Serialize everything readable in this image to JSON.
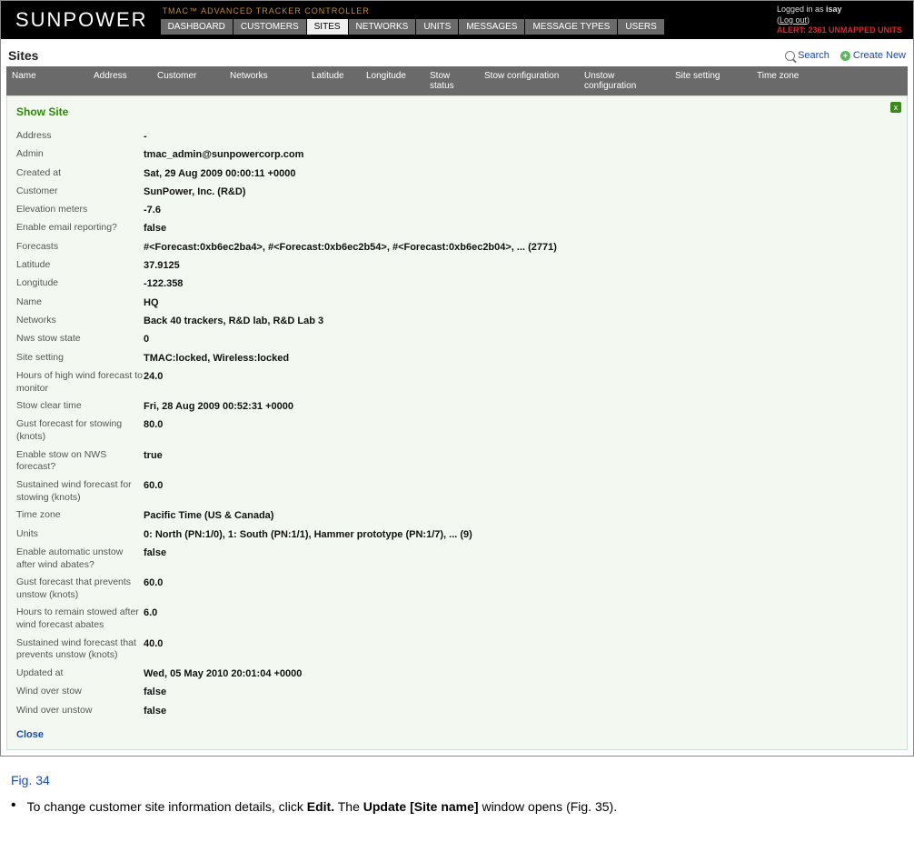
{
  "header": {
    "brand": "SUNPOWER",
    "subtitle": "TMAC™ ADVANCED TRACKER CONTROLLER",
    "login_prefix": "Logged in as ",
    "login_user": "isay",
    "logout_label": "Log out",
    "alert_text": "ALERT: 2361 UNMAPPED UNITS"
  },
  "tabs": {
    "dashboard": "DASHBOARD",
    "customers": "CUSTOMERS",
    "sites": "SITES",
    "networks": "NETWORKS",
    "units": "UNITS",
    "messages": "MESSAGES",
    "message_types": "MESSAGE TYPES",
    "users": "USERS"
  },
  "sites": {
    "title": "Sites",
    "search_label": "Search",
    "create_label": "Create New"
  },
  "columns": {
    "name": "Name",
    "address": "Address",
    "customer": "Customer",
    "networks": "Networks",
    "latitude": "Latitude",
    "longitude": "Longitude",
    "stow_status": "Stow status",
    "stow_config": "Stow configuration",
    "unstow_config": "Unstow configuration",
    "site_setting": "Site setting",
    "time_zone": "Time zone"
  },
  "detail": {
    "heading": "Show Site",
    "close_x": "x",
    "close_label": "Close",
    "rows": {
      "address": {
        "k": "Address",
        "v": "-"
      },
      "admin": {
        "k": "Admin",
        "v": "tmac_admin@sunpowercorp.com"
      },
      "created_at": {
        "k": "Created at",
        "v": "Sat, 29 Aug 2009 00:00:11 +0000"
      },
      "customer": {
        "k": "Customer",
        "v": "SunPower, Inc. (R&D)"
      },
      "elevation": {
        "k": "Elevation meters",
        "v": "-7.6"
      },
      "enable_email": {
        "k": "Enable email reporting?",
        "v": "false"
      },
      "forecasts": {
        "k": "Forecasts",
        "v": "#<Forecast:0xb6ec2ba4>, #<Forecast:0xb6ec2b54>, #<Forecast:0xb6ec2b04>, ... (2771)"
      },
      "latitude": {
        "k": "Latitude",
        "v": "37.9125"
      },
      "longitude": {
        "k": "Longitude",
        "v": "-122.358"
      },
      "name": {
        "k": "Name",
        "v": "HQ"
      },
      "networks": {
        "k": "Networks",
        "v": "Back 40 trackers, R&D lab, R&D Lab 3"
      },
      "nws_stow": {
        "k": "Nws stow state",
        "v": "0"
      },
      "site_setting": {
        "k": "Site setting",
        "v": "TMAC:locked, Wireless:locked"
      },
      "hours_high_wind": {
        "k": "Hours of high wind forecast to monitor",
        "v": "24.0"
      },
      "stow_clear": {
        "k": "Stow clear time",
        "v": "Fri, 28 Aug 2009 00:52:31 +0000"
      },
      "gust_stow": {
        "k": "Gust forecast for stowing (knots)",
        "v": "80.0"
      },
      "enable_stow_nws": {
        "k": "Enable stow on NWS forecast?",
        "v": "true"
      },
      "sustained_stow": {
        "k": "Sustained wind forecast for stowing (knots)",
        "v": "60.0"
      },
      "timezone": {
        "k": "Time zone",
        "v": "Pacific Time (US & Canada)"
      },
      "units": {
        "k": "Units",
        "v": "0: North (PN:1/0), 1: South (PN:1/1), Hammer prototype (PN:1/7), ... (9)"
      },
      "enable_auto_unstow": {
        "k": "Enable automatic unstow after wind abates?",
        "v": "false"
      },
      "gust_prevent_unstow": {
        "k": "Gust forecast that prevents unstow (knots)",
        "v": "60.0"
      },
      "hours_remain_stowed": {
        "k": "Hours to remain stowed after wind forecast abates",
        "v": "6.0"
      },
      "sustained_prevent_unstow": {
        "k": "Sustained wind forecast that prevents unstow (knots)",
        "v": "40.0"
      },
      "updated_at": {
        "k": "Updated at",
        "v": "Wed, 05 May 2010 20:01:04 +0000"
      },
      "wind_over_stow": {
        "k": "Wind over stow",
        "v": "false"
      },
      "wind_over_unstow": {
        "k": "Wind over unstow",
        "v": "false"
      }
    }
  },
  "caption": {
    "figure": "Fig. 34",
    "bullet_pre": "To change customer site information details, click ",
    "bullet_b1": "Edit.",
    "bullet_mid": " The ",
    "bullet_b2": "Update [Site name]",
    "bullet_post": " window opens (Fig. 35)."
  }
}
